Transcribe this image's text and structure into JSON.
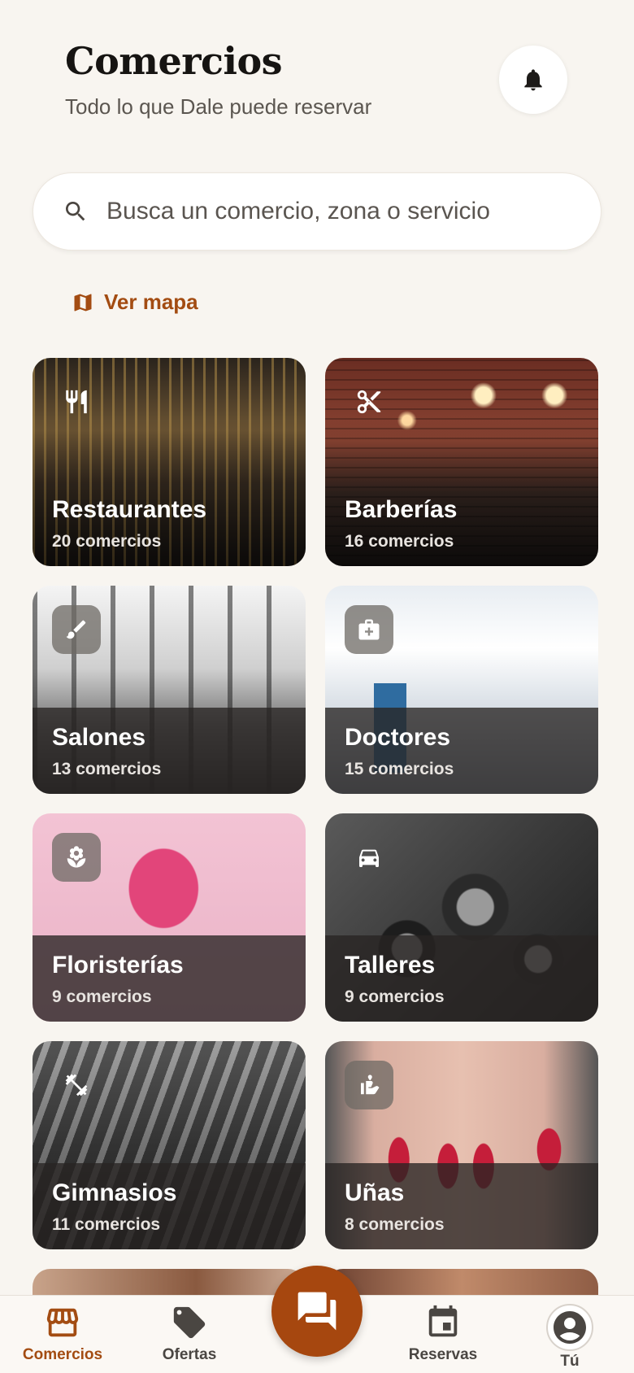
{
  "header": {
    "title": "Comercios",
    "subtitle": "Todo lo que Dale puede reservar"
  },
  "search": {
    "placeholder": "Busca un comercio, zona o servicio"
  },
  "map_link": {
    "label": "Ver mapa"
  },
  "categories": [
    {
      "name": "Restaurantes",
      "count": "20 comercios",
      "icon": "fork-knife-icon"
    },
    {
      "name": "Barberías",
      "count": "16 comercios",
      "icon": "scissors-icon"
    },
    {
      "name": "Salones",
      "count": "13 comercios",
      "icon": "brush-icon"
    },
    {
      "name": "Doctores",
      "count": "15 comercios",
      "icon": "medical-bag-icon"
    },
    {
      "name": "Floristerías",
      "count": "9 comercios",
      "icon": "flower-icon"
    },
    {
      "name": "Talleres",
      "count": "9 comercios",
      "icon": "car-icon"
    },
    {
      "name": "Gimnasios",
      "count": "11 comercios",
      "icon": "dumbbell-icon"
    },
    {
      "name": "Uñas",
      "count": "8 comercios",
      "icon": "hand-spa-icon"
    }
  ],
  "nav": {
    "comercios": "Comercios",
    "ofertas": "Ofertas",
    "reservas": "Reservas",
    "tu": "Tú"
  },
  "colors": {
    "accent": "#a34c12",
    "background": "#f8f5f0"
  }
}
